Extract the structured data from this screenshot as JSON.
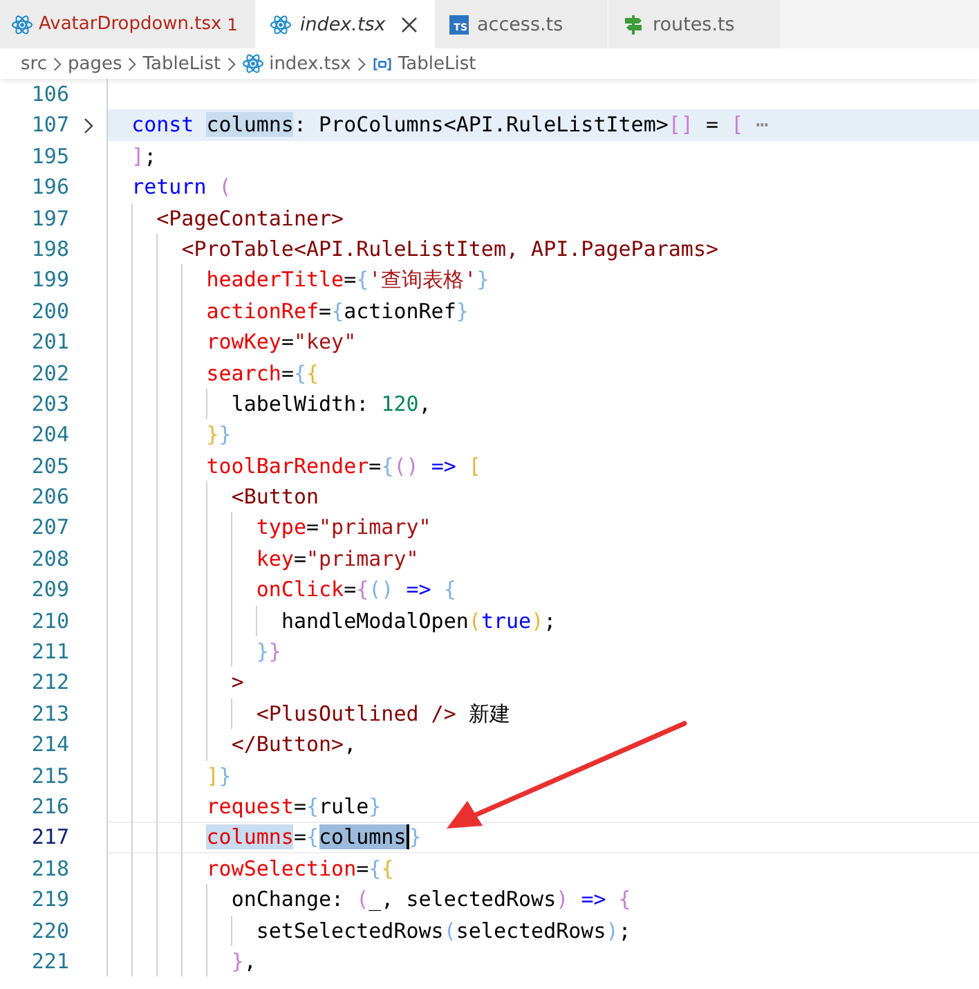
{
  "tabs": [
    {
      "label": "AvatarDropdown.tsx",
      "kind": "react",
      "selected": false,
      "italic": false,
      "error": true,
      "problems": "1"
    },
    {
      "label": "index.tsx",
      "kind": "react",
      "selected": true,
      "italic": true,
      "error": false
    },
    {
      "label": "access.ts",
      "kind": "ts",
      "icon_text": "TS",
      "selected": false,
      "italic": false,
      "error": false
    },
    {
      "label": "routes.ts",
      "kind": "signpost",
      "selected": false,
      "italic": false,
      "error": false
    }
  ],
  "breadcrumb": [
    {
      "label": "src"
    },
    {
      "label": "pages"
    },
    {
      "label": "TableList"
    },
    {
      "label": "index.tsx",
      "kind": "react"
    },
    {
      "label": "TableList",
      "kind": "symbol"
    }
  ],
  "lines": [
    {
      "number": "106",
      "folded": false,
      "current": false
    },
    {
      "number": "107",
      "folded": true,
      "current": false,
      "tokens": [
        {
          "text": "  const ",
          "kind": "keyword"
        },
        {
          "text": "columns",
          "kind": "text",
          "match": true
        },
        {
          "text": ": ProColumns<API.RuleListItem>",
          "kind": "text"
        },
        {
          "text": "[]",
          "kind": "bracket_pink"
        },
        {
          "text": " = ",
          "kind": "text"
        },
        {
          "text": "[ ",
          "kind": "bracket_pink"
        },
        {
          "text": "⋯",
          "kind": "fold"
        }
      ]
    },
    {
      "number": "195",
      "folded": false,
      "current": false,
      "tokens": [
        {
          "text": "  ]",
          "kind": "bracket_pink"
        },
        {
          "text": ";",
          "kind": "text"
        }
      ]
    },
    {
      "number": "196",
      "folded": false,
      "current": false,
      "tokens": [
        {
          "text": "  return ",
          "kind": "keyword"
        },
        {
          "text": "(",
          "kind": "bracket_pink"
        }
      ]
    },
    {
      "number": "197",
      "folded": false,
      "current": false,
      "tokens": [
        {
          "text": "    <PageContainer>",
          "kind": "tag"
        }
      ]
    },
    {
      "number": "198",
      "folded": false,
      "current": false,
      "tokens": [
        {
          "text": "      <ProTable<API.RuleListItem, API.PageParams>",
          "kind": "tag"
        }
      ]
    },
    {
      "number": "199",
      "folded": false,
      "current": false,
      "tokens": [
        {
          "text": "        headerTitle",
          "kind": "attr"
        },
        {
          "text": "=",
          "kind": "text"
        },
        {
          "text": "{",
          "kind": "bracket_blue"
        },
        {
          "text": "'查询表格'",
          "kind": "string"
        },
        {
          "text": "}",
          "kind": "bracket_blue"
        }
      ]
    },
    {
      "number": "200",
      "folded": false,
      "current": false,
      "tokens": [
        {
          "text": "        actionRef",
          "kind": "attr"
        },
        {
          "text": "=",
          "kind": "text"
        },
        {
          "text": "{",
          "kind": "bracket_blue"
        },
        {
          "text": "actionRef",
          "kind": "text"
        },
        {
          "text": "}",
          "kind": "bracket_blue"
        }
      ]
    },
    {
      "number": "201",
      "folded": false,
      "current": false,
      "tokens": [
        {
          "text": "        rowKey",
          "kind": "attr"
        },
        {
          "text": "=",
          "kind": "text"
        },
        {
          "text": "\"key\"",
          "kind": "string"
        }
      ]
    },
    {
      "number": "202",
      "folded": false,
      "current": false,
      "tokens": [
        {
          "text": "        search",
          "kind": "attr"
        },
        {
          "text": "=",
          "kind": "text"
        },
        {
          "text": "{",
          "kind": "bracket_blue"
        },
        {
          "text": "{",
          "kind": "bracket_gold"
        }
      ]
    },
    {
      "number": "203",
      "folded": false,
      "current": false,
      "tokens": [
        {
          "text": "          labelWidth: ",
          "kind": "text"
        },
        {
          "text": "120",
          "kind": "number"
        },
        {
          "text": ",",
          "kind": "text"
        }
      ]
    },
    {
      "number": "204",
      "folded": false,
      "current": false,
      "tokens": [
        {
          "text": "        }",
          "kind": "bracket_gold"
        },
        {
          "text": "}",
          "kind": "bracket_blue"
        }
      ]
    },
    {
      "number": "205",
      "folded": false,
      "current": false,
      "tokens": [
        {
          "text": "        toolBarRender",
          "kind": "attr"
        },
        {
          "text": "=",
          "kind": "text"
        },
        {
          "text": "{",
          "kind": "bracket_blue"
        },
        {
          "text": "() ",
          "kind": "bracket_pink"
        },
        {
          "text": "=> ",
          "kind": "keyword"
        },
        {
          "text": "[",
          "kind": "bracket_gold"
        }
      ]
    },
    {
      "number": "206",
      "folded": false,
      "current": false,
      "tokens": [
        {
          "text": "          <Button",
          "kind": "tag"
        }
      ]
    },
    {
      "number": "207",
      "folded": false,
      "current": false,
      "tokens": [
        {
          "text": "            type",
          "kind": "attr"
        },
        {
          "text": "=",
          "kind": "text"
        },
        {
          "text": "\"primary\"",
          "kind": "string"
        }
      ]
    },
    {
      "number": "208",
      "folded": false,
      "current": false,
      "tokens": [
        {
          "text": "            key",
          "kind": "attr"
        },
        {
          "text": "=",
          "kind": "text"
        },
        {
          "text": "\"primary\"",
          "kind": "string"
        }
      ]
    },
    {
      "number": "209",
      "folded": false,
      "current": false,
      "tokens": [
        {
          "text": "            onClick",
          "kind": "attr"
        },
        {
          "text": "=",
          "kind": "text"
        },
        {
          "text": "{",
          "kind": "bracket_pink"
        },
        {
          "text": "() ",
          "kind": "bracket_blue"
        },
        {
          "text": "=> ",
          "kind": "keyword"
        },
        {
          "text": "{",
          "kind": "bracket_blue"
        }
      ]
    },
    {
      "number": "210",
      "folded": false,
      "current": false,
      "tokens": [
        {
          "text": "              handleModalOpen",
          "kind": "text"
        },
        {
          "text": "(",
          "kind": "bracket_gold"
        },
        {
          "text": "true",
          "kind": "keyword"
        },
        {
          "text": ")",
          "kind": "bracket_gold"
        },
        {
          "text": ";",
          "kind": "text"
        }
      ]
    },
    {
      "number": "211",
      "folded": false,
      "current": false,
      "tokens": [
        {
          "text": "            }",
          "kind": "bracket_blue"
        },
        {
          "text": "}",
          "kind": "bracket_pink"
        }
      ]
    },
    {
      "number": "212",
      "folded": false,
      "current": false,
      "tokens": [
        {
          "text": "          >",
          "kind": "tag"
        }
      ]
    },
    {
      "number": "213",
      "folded": false,
      "current": false,
      "tokens": [
        {
          "text": "            <PlusOutlined />",
          "kind": "tag"
        },
        {
          "text": " 新建",
          "kind": "text"
        }
      ]
    },
    {
      "number": "214",
      "folded": false,
      "current": false,
      "tokens": [
        {
          "text": "          </Button>",
          "kind": "tag"
        },
        {
          "text": ",",
          "kind": "text"
        }
      ]
    },
    {
      "number": "215",
      "folded": false,
      "current": false,
      "tokens": [
        {
          "text": "        ]",
          "kind": "bracket_gold"
        },
        {
          "text": "}",
          "kind": "bracket_blue"
        }
      ]
    },
    {
      "number": "216",
      "folded": false,
      "current": false,
      "tokens": [
        {
          "text": "        request",
          "kind": "attr"
        },
        {
          "text": "=",
          "kind": "text"
        },
        {
          "text": "{",
          "kind": "bracket_blue"
        },
        {
          "text": "rule",
          "kind": "text"
        },
        {
          "text": "}",
          "kind": "bracket_blue"
        }
      ]
    },
    {
      "number": "217",
      "folded": false,
      "current": true,
      "tokens": [
        {
          "text": "        columns",
          "kind": "attr",
          "match": true
        },
        {
          "text": "=",
          "kind": "text"
        },
        {
          "text": "{",
          "kind": "bracket_blue"
        },
        {
          "text": "columns",
          "kind": "text",
          "selection": true,
          "caret": true
        },
        {
          "text": "}",
          "kind": "bracket_blue"
        }
      ]
    },
    {
      "number": "218",
      "folded": false,
      "current": false,
      "tokens": [
        {
          "text": "        rowSelection",
          "kind": "attr"
        },
        {
          "text": "=",
          "kind": "text"
        },
        {
          "text": "{",
          "kind": "bracket_blue"
        },
        {
          "text": "{",
          "kind": "bracket_gold"
        }
      ]
    },
    {
      "number": "219",
      "folded": false,
      "current": false,
      "tokens": [
        {
          "text": "          onChange: ",
          "kind": "text"
        },
        {
          "text": "(",
          "kind": "bracket_pink"
        },
        {
          "text": "_, selectedRows",
          "kind": "text"
        },
        {
          "text": ") ",
          "kind": "bracket_pink"
        },
        {
          "text": "=> ",
          "kind": "keyword"
        },
        {
          "text": "{",
          "kind": "bracket_pink"
        }
      ]
    },
    {
      "number": "220",
      "folded": false,
      "current": false,
      "tokens": [
        {
          "text": "            setSelectedRows",
          "kind": "text"
        },
        {
          "text": "(",
          "kind": "bracket_blue"
        },
        {
          "text": "selectedRows",
          "kind": "text"
        },
        {
          "text": ")",
          "kind": "bracket_blue"
        },
        {
          "text": ";",
          "kind": "text"
        }
      ]
    },
    {
      "number": "221",
      "folded": false,
      "current": false,
      "tokens": [
        {
          "text": "          }",
          "kind": "bracket_pink"
        },
        {
          "text": ",",
          "kind": "text"
        }
      ]
    }
  ]
}
